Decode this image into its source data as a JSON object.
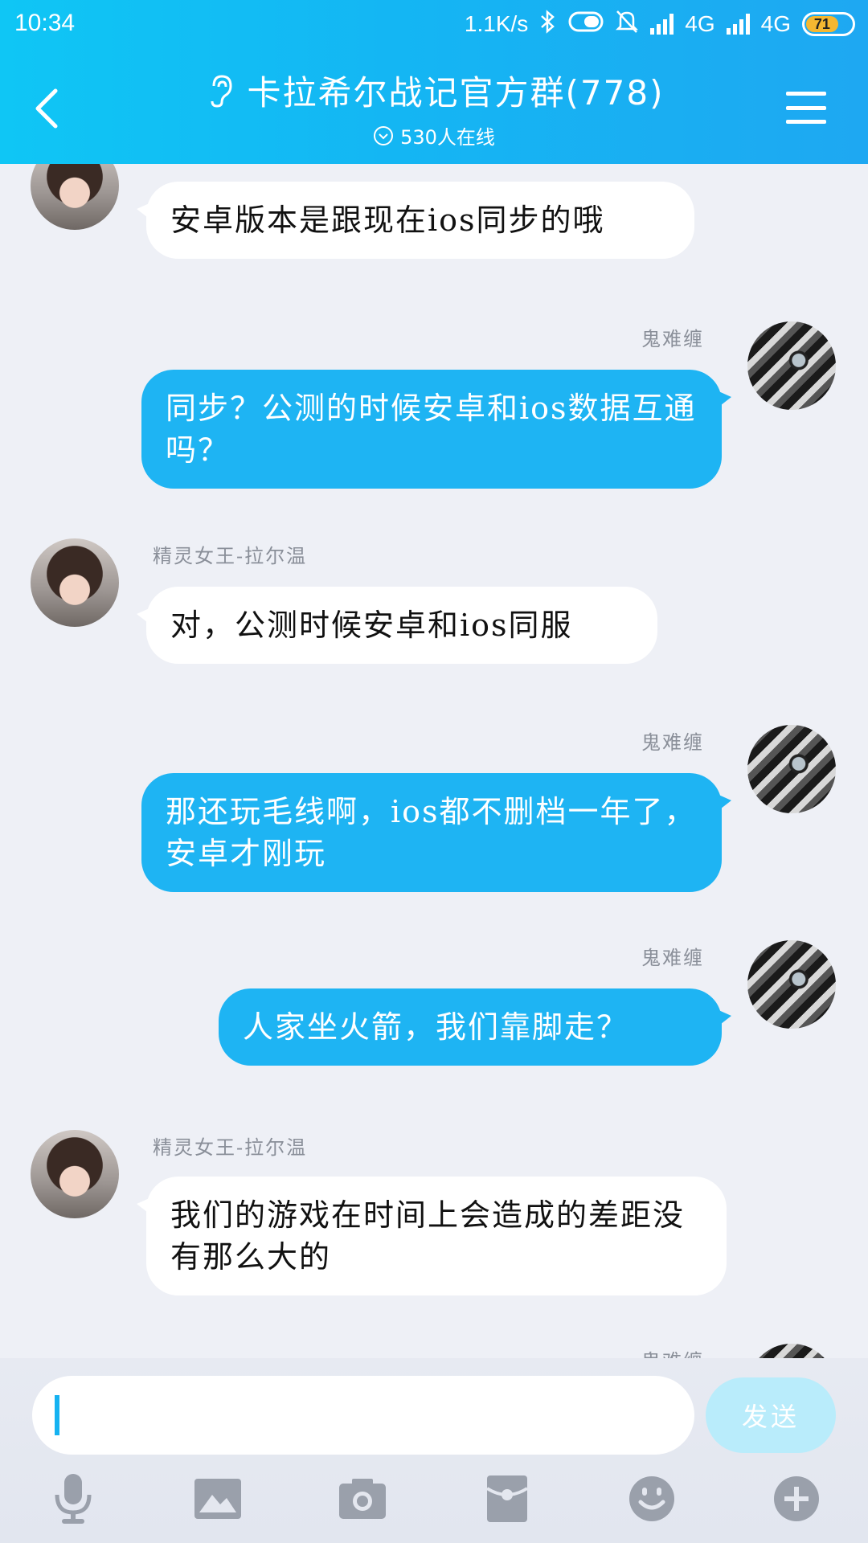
{
  "status_bar": {
    "time": "10:34",
    "net_speed": "1.1K/s",
    "network_1": "4G",
    "network_2": "4G",
    "battery": "71"
  },
  "header": {
    "title": "卡拉希尔战记官方群(778)",
    "online": "530人在线"
  },
  "messages": [
    {
      "side": "in",
      "sender": "",
      "text": "安卓版本是跟现在ios同步的哦"
    },
    {
      "side": "out",
      "sender": "鬼难缠",
      "text": "同步？公测的时候安卓和ios数据互通吗？"
    },
    {
      "side": "in",
      "sender": "精灵女王-拉尔温",
      "text": "对，公测时候安卓和ios同服"
    },
    {
      "side": "out",
      "sender": "鬼难缠",
      "text": "那还玩毛线啊，ios都不删档一年了，安卓才刚玩"
    },
    {
      "side": "out",
      "sender": "鬼难缠",
      "text": "人家坐火箭，我们靠脚走？"
    },
    {
      "side": "in",
      "sender": "精灵女王-拉尔温",
      "text": "我们的游戏在时间上会造成的差距没有那么大的"
    },
    {
      "side": "out",
      "sender": "鬼难缠",
      "text": ""
    }
  ],
  "composer": {
    "send_label": "发送",
    "placeholder": ""
  },
  "icons": [
    "mic-icon",
    "image-icon",
    "camera-icon",
    "red-packet-icon",
    "emoji-icon",
    "plus-icon"
  ],
  "colors": {
    "header_gradient_start": "#0fc6f5",
    "header_gradient_end": "#1ea8f2",
    "outgoing_bubble": "#1eb4f3",
    "incoming_bubble": "#ffffff",
    "send_button": "#b9ecfb",
    "background": "#eef0f6"
  }
}
